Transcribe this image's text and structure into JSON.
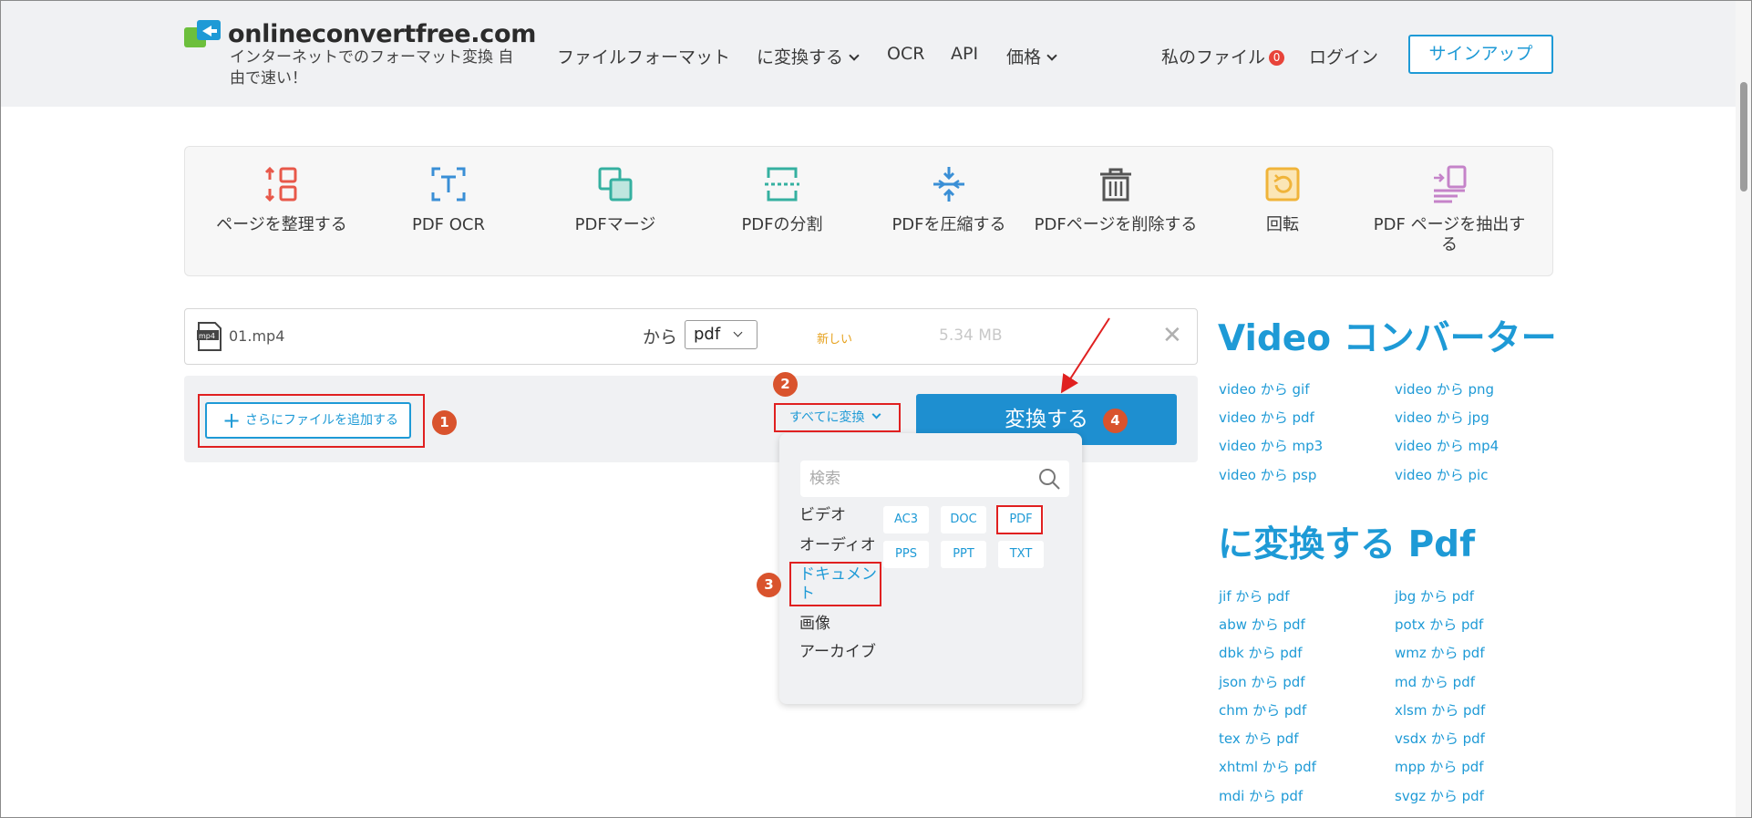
{
  "header": {
    "brand": "onlineconvertfree.com",
    "tagline": "インターネットでのフォーマット変換 自由で速い！",
    "nav": {
      "file_formats": "ファイルフォーマット",
      "convert_to": "に変換する",
      "ocr": "OCR",
      "api": "API",
      "pricing": "価格"
    },
    "my_files": "私のファイル",
    "my_files_count": "0",
    "login": "ログイン",
    "signup": "サインアップ"
  },
  "tools": [
    {
      "label": "ページを整理する",
      "icon": "organize-pages-icon"
    },
    {
      "label": "PDF OCR",
      "icon": "ocr-icon"
    },
    {
      "label": "PDFマージ",
      "icon": "merge-icon"
    },
    {
      "label": "PDFの分割",
      "icon": "split-icon"
    },
    {
      "label": "PDFを圧縮する",
      "icon": "compress-icon"
    },
    {
      "label": "PDFページを削除する",
      "icon": "trash-icon"
    },
    {
      "label": "回転",
      "icon": "rotate-icon"
    },
    {
      "label": "PDF ページを抽出する",
      "icon": "extract-icon"
    }
  ],
  "file": {
    "icon_text": "mp4",
    "name": "01.mp4",
    "from": "から",
    "format": "pdf",
    "status": "新しい",
    "size": "5.34 MB",
    "close": "✕"
  },
  "actions": {
    "add_files": "さらにファイルを追加する",
    "convert_all": "すべてに変換",
    "convert": "変換する"
  },
  "dropdown": {
    "search_placeholder": "検索",
    "categories": [
      "ビデオ",
      "オーディオ",
      "ドキュメント",
      "画像",
      "アーカイブ"
    ],
    "formats": [
      "AC3",
      "DOC",
      "PDF",
      "PPS",
      "PPT",
      "TXT"
    ]
  },
  "sidebar": {
    "video_title": "Video コンバーター",
    "video_links": [
      "video から gif",
      "video から png",
      "video から pdf",
      "video から jpg",
      "video から mp3",
      "video から mp4",
      "video から psp",
      "video から pic"
    ],
    "pdf_title": "に変換する Pdf",
    "pdf_links": [
      "jif から pdf",
      "jbg から pdf",
      "abw から pdf",
      "potx から pdf",
      "dbk から pdf",
      "wmz から pdf",
      "json から pdf",
      "md から pdf",
      "chm から pdf",
      "xlsm から pdf",
      "tex から pdf",
      "vsdx から pdf",
      "xhtml から pdf",
      "mpp から pdf",
      "mdi から pdf",
      "svgz から pdf"
    ]
  },
  "annotations": [
    "1",
    "2",
    "3",
    "4"
  ],
  "colors": {
    "accent": "#1e9ad6",
    "header_bg": "#f0f1f3",
    "annotation_red": "#e02020",
    "step_badge": "#d9532d"
  }
}
